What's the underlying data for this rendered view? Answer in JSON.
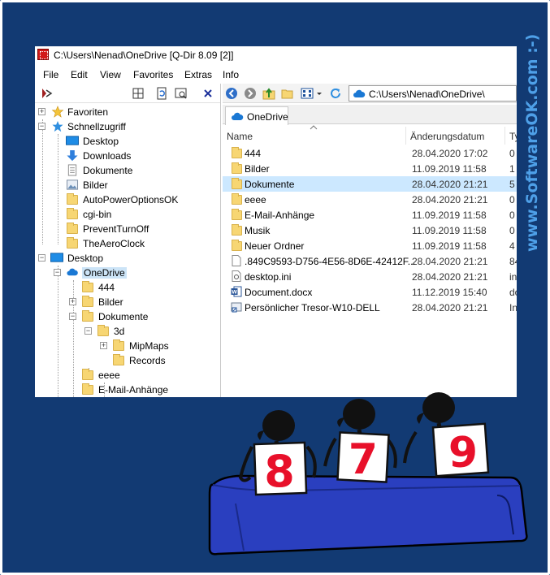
{
  "window": {
    "title": "C:\\Users\\Nenad\\OneDrive  [Q-Dir 8.09 [2]]"
  },
  "menu": [
    "File",
    "Edit",
    "View",
    "Favorites",
    "Extras",
    "Info"
  ],
  "tree": [
    {
      "label": "Favoriten",
      "icon": "star-icon"
    },
    {
      "label": "Schnellzugriff",
      "icon": "pin-star-icon"
    },
    {
      "label": "Desktop",
      "icon": "desktop-icon"
    },
    {
      "label": "Downloads",
      "icon": "download-arrow-icon"
    },
    {
      "label": "Dokumente",
      "icon": "documents-icon"
    },
    {
      "label": "Bilder",
      "icon": "pictures-icon"
    },
    {
      "label": "AutoPowerOptionsOK",
      "icon": "folder-icon"
    },
    {
      "label": "cgi-bin",
      "icon": "folder-icon"
    },
    {
      "label": "PreventTurnOff",
      "icon": "folder-icon"
    },
    {
      "label": "TheAeroClock",
      "icon": "folder-icon"
    },
    {
      "label": "Desktop",
      "icon": "desktop-icon"
    },
    {
      "label": "OneDrive",
      "icon": "cloud-icon"
    },
    {
      "label": "444",
      "icon": "folder-icon"
    },
    {
      "label": "Bilder",
      "icon": "folder-icon"
    },
    {
      "label": "Dokumente",
      "icon": "folder-icon"
    },
    {
      "label": "3d",
      "icon": "folder-icon"
    },
    {
      "label": "MipMaps",
      "icon": "folder-icon"
    },
    {
      "label": "Records",
      "icon": "folder-icon"
    },
    {
      "label": "eeee",
      "icon": "folder-icon"
    },
    {
      "label": "E-Mail-Anhänge",
      "icon": "folder-icon"
    }
  ],
  "address": {
    "path": "C:\\Users\\Nenad\\OneDrive\\"
  },
  "tab": {
    "label": "OneDrive"
  },
  "columns": {
    "name": "Name",
    "date": "Änderungsdatum",
    "type": "Ty"
  },
  "files": [
    {
      "name": "444",
      "date": "28.04.2020 17:02",
      "type": "0",
      "icon": "folder-icon"
    },
    {
      "name": "Bilder",
      "date": "11.09.2019 11:58",
      "type": "1",
      "icon": "folder-icon"
    },
    {
      "name": "Dokumente",
      "date": "28.04.2020 21:21",
      "type": "5",
      "icon": "folder-icon"
    },
    {
      "name": "eeee",
      "date": "28.04.2020 21:21",
      "type": "0",
      "icon": "folder-icon"
    },
    {
      "name": "E-Mail-Anhänge",
      "date": "11.09.2019 11:58",
      "type": "0",
      "icon": "folder-icon"
    },
    {
      "name": "Musik",
      "date": "11.09.2019 11:58",
      "type": "0",
      "icon": "folder-icon"
    },
    {
      "name": "Neuer Ordner",
      "date": "11.09.2019 11:58",
      "type": "4",
      "icon": "folder-icon"
    },
    {
      "name": ".849C9593-D756-4E56-8D6E-42412F...",
      "date": "28.04.2020 21:21",
      "type": "84",
      "icon": "file-icon"
    },
    {
      "name": "desktop.ini",
      "date": "28.04.2020 21:21",
      "type": "in",
      "icon": "settings-file-icon"
    },
    {
      "name": "Document.docx",
      "date": "11.12.2019 15:40",
      "type": "do",
      "icon": "word-doc-icon"
    },
    {
      "name": "Persönlicher Tresor-W10-DELL",
      "date": "28.04.2020 21:21",
      "type": "In",
      "icon": "vault-shortcut-icon"
    }
  ],
  "watermark": "www.SoftwareOK.com :-)",
  "cards": [
    "8",
    "7",
    "9"
  ],
  "colors": {
    "background": "#123a73",
    "watermark": "#4ea0e8",
    "selection": "#cce8ff",
    "card_number": "#e8102a",
    "table": "#2a3fbf"
  }
}
